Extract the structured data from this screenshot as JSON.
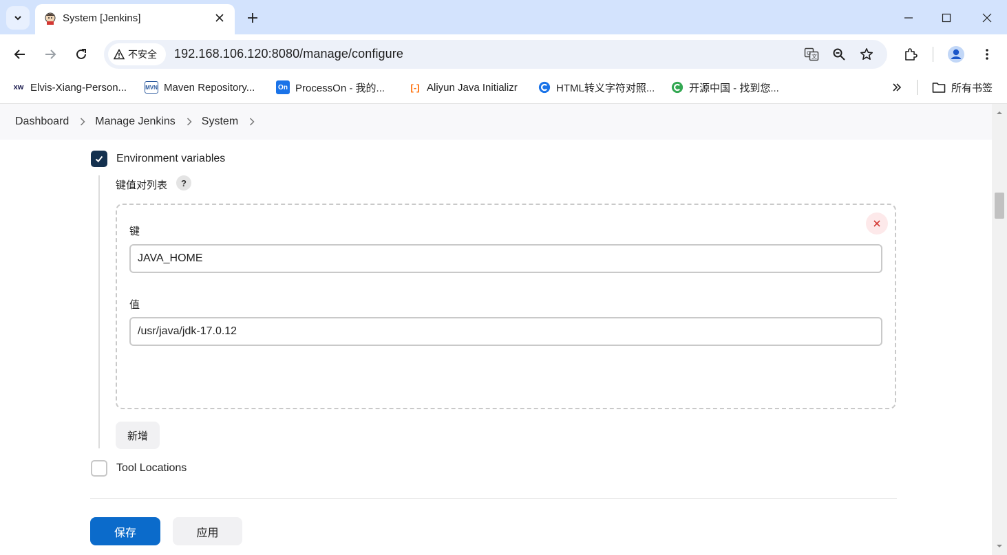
{
  "browser": {
    "tab": {
      "title": "System [Jenkins]"
    },
    "omnibox": {
      "security_label": "不安全",
      "url": "192.168.106.120:8080/manage/configure"
    },
    "bookmarks": [
      {
        "label": "Elvis-Xiang-Person...",
        "icon": "xw-icon"
      },
      {
        "label": "Maven Repository...",
        "icon": "mvn-icon"
      },
      {
        "label": "ProcessOn - 我的...",
        "icon": "processon-icon"
      },
      {
        "label": "Aliyun Java Initializr",
        "icon": "aliyun-icon"
      },
      {
        "label": "HTML转义字符对照...",
        "icon": "html-escape-icon"
      },
      {
        "label": "开源中国 - 找到您...",
        "icon": "oschina-icon"
      }
    ],
    "all_bookmarks_label": "所有书签"
  },
  "breadcrumb": [
    "Dashboard",
    "Manage Jenkins",
    "System"
  ],
  "env": {
    "checkbox_label": "Environment variables",
    "checked": true,
    "list_title": "键值对列表",
    "help_label": "?",
    "entry": {
      "key_label": "键",
      "key_value": "JAVA_HOME",
      "value_label": "值",
      "value_value": "/usr/java/jdk-17.0.12"
    },
    "add_label": "新增"
  },
  "tool_locations": {
    "label": "Tool Locations",
    "checked": false
  },
  "actions": {
    "save_label": "保存",
    "apply_label": "应用"
  },
  "colors": {
    "tabstrip": "#d3e3fd",
    "checkbox_checked": "#14314f",
    "primary_button": "#0b6bcb",
    "delete_icon": "#d33833"
  }
}
